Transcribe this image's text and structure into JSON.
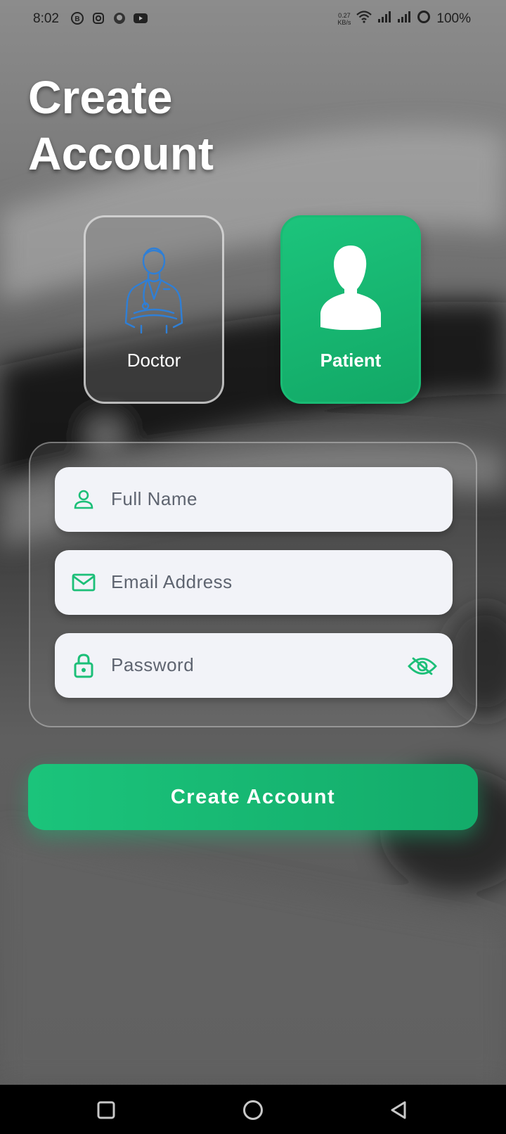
{
  "status_bar": {
    "time": "8:02",
    "net_speed_value": "0.27",
    "net_speed_unit": "KB/s",
    "battery": "100%",
    "left_icons": [
      "b-icon",
      "instagram-icon",
      "notification-icon",
      "youtube-icon"
    ],
    "right_icons": [
      "wifi-icon",
      "signal-icon",
      "signal-icon",
      "battery-ring-icon"
    ]
  },
  "page": {
    "title": "Create Account"
  },
  "roles": {
    "doctor": {
      "label": "Doctor",
      "icon": "doctor-outline-icon"
    },
    "patient": {
      "label": "Patient",
      "icon": "person-silhouette-icon",
      "selected": true
    }
  },
  "form": {
    "full_name": {
      "placeholder": "Full Name",
      "icon": "person-icon"
    },
    "email": {
      "placeholder": "Email Address",
      "icon": "mail-icon"
    },
    "password": {
      "placeholder": "Password",
      "icon": "lock-icon",
      "toggle_icon": "eye-off-icon"
    }
  },
  "submit": {
    "label": "Create Account"
  },
  "colors": {
    "accent": "#1cbf78",
    "doctor_icon": "#2f7fd6",
    "field_bg": "#f2f3f8",
    "placeholder": "#5e6470"
  },
  "nav": [
    "recents-square-icon",
    "home-circle-icon",
    "back-triangle-icon"
  ]
}
